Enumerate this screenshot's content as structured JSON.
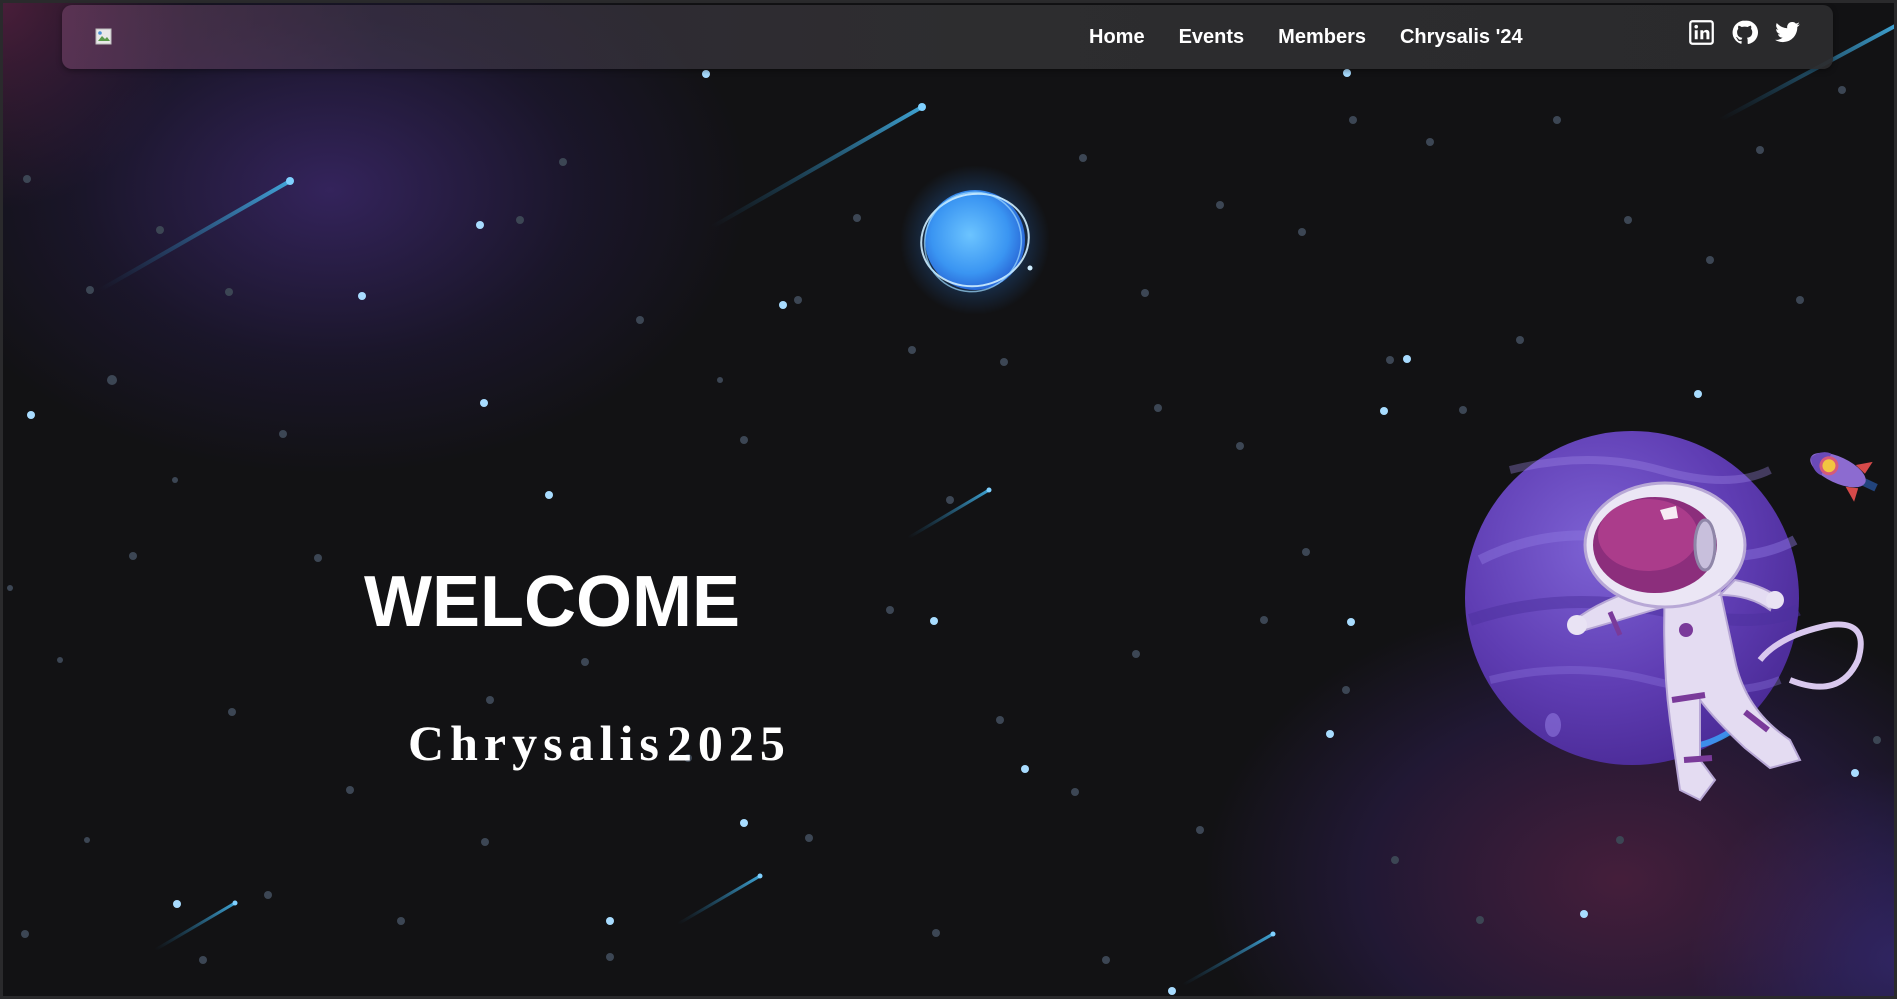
{
  "navbar": {
    "logo_alt": "",
    "links": [
      "Home",
      "Events",
      "Members",
      "Chrysalis '24"
    ],
    "social_icons": [
      "linkedin-icon",
      "github-icon",
      "twitter-icon"
    ]
  },
  "hero": {
    "title": "WELCOME",
    "subtitle_word": "Chrysalis",
    "subtitle_year": "2025"
  },
  "illustrations": [
    "glowing-blue-planet",
    "purple-planet",
    "astronaut",
    "rocket",
    "shooting-stars",
    "stars"
  ],
  "colors": {
    "background": "#121214",
    "text": "#ffffff",
    "star": "#a8dcff",
    "planet_purple": "#6a45c0",
    "planet_blue": "#3ea0ff"
  }
}
